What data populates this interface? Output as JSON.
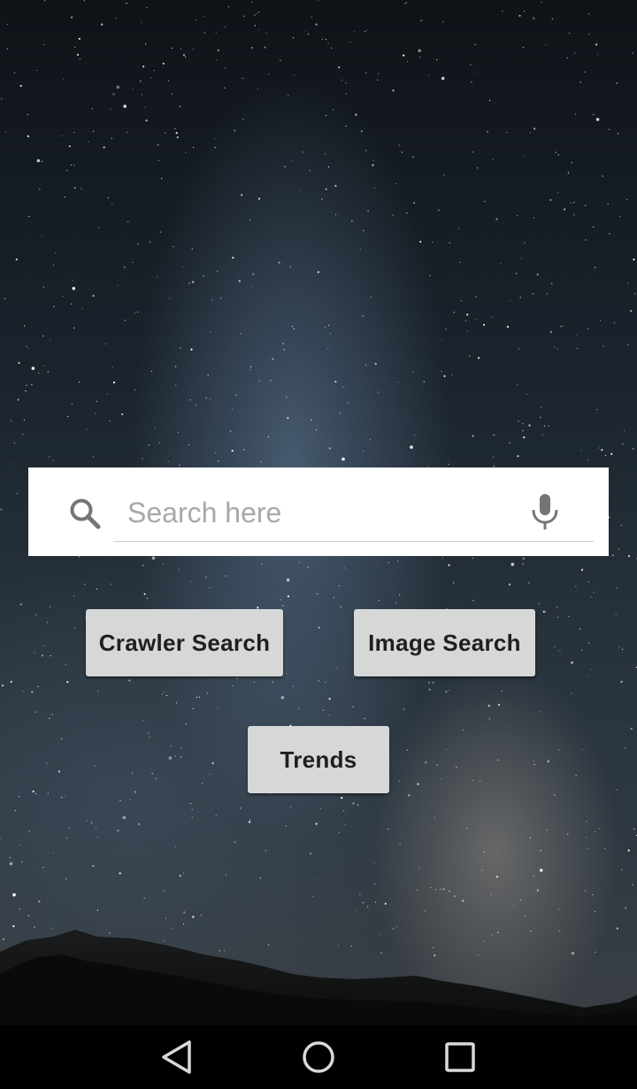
{
  "search": {
    "placeholder": "Search here",
    "value": ""
  },
  "buttons": {
    "crawler_search": "Crawler Search",
    "image_search": "Image Search",
    "trends": "Trends"
  },
  "icons": {
    "search": "search-icon",
    "mic": "mic-icon",
    "nav_back": "back-triangle-icon",
    "nav_home": "home-circle-icon",
    "nav_recent": "recent-apps-square-icon"
  },
  "colors": {
    "search_bar_bg": "#ffffff",
    "button_bg": "#d6d7d7",
    "icon_gray": "#757575",
    "nav_bar_bg": "#000000",
    "nav_icon": "#d9d9d9"
  }
}
